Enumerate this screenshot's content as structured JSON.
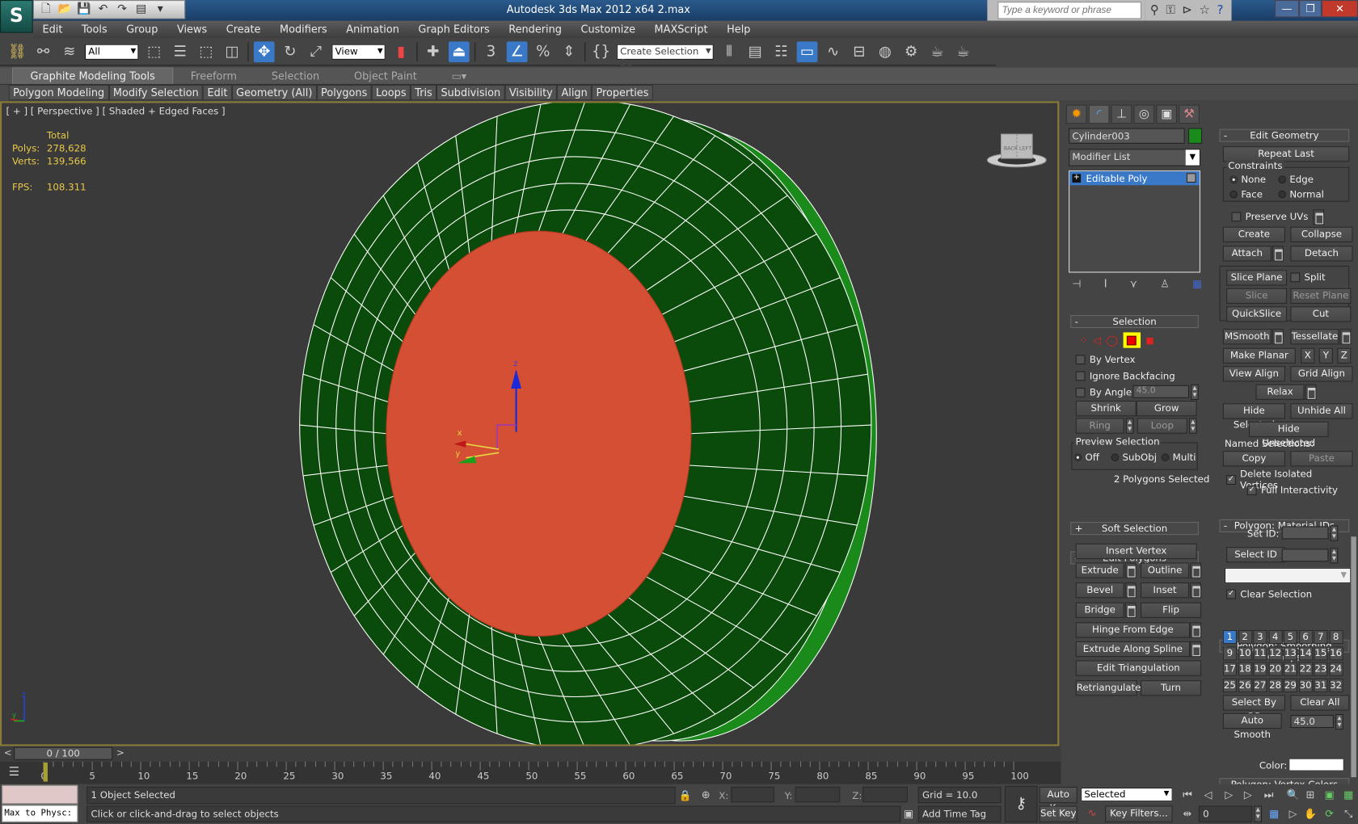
{
  "window": {
    "title": "Autodesk 3ds Max  2012 x64     2.max",
    "search_placeholder": "Type a keyword or phrase",
    "minimize": "—",
    "restore": "❐",
    "close": "✕"
  },
  "menubar": [
    "Edit",
    "Tools",
    "Group",
    "Views",
    "Create",
    "Modifiers",
    "Animation",
    "Graph Editors",
    "Rendering",
    "Customize",
    "MAXScript",
    "Help"
  ],
  "toolbar": {
    "selection_filter": "All",
    "ref_coord": "View",
    "named_selection_placeholder": "Create Selection Se",
    "snap_label": "3"
  },
  "ribbon": {
    "tabs": [
      "Graphite Modeling Tools",
      "Freeform",
      "Selection",
      "Object Paint"
    ],
    "panels": [
      "Polygon Modeling",
      "Modify Selection",
      "Edit",
      "Geometry (All)",
      "Polygons",
      "Loops",
      "Tris",
      "Subdivision",
      "Visibility",
      "Align",
      "Properties"
    ]
  },
  "viewport": {
    "label": "[ + ] [ Perspective ] [ Shaded + Edged Faces ]",
    "stats": {
      "header": "Total",
      "polys_label": "Polys:",
      "polys": "278,628",
      "verts_label": "Verts:",
      "verts": "139,566",
      "fps_label": "FPS:",
      "fps": "108.311"
    },
    "gizmo": {
      "x": "x",
      "y": "y",
      "z": "z"
    },
    "viewcube": {
      "left": "LEFT",
      "front": "BACK"
    },
    "colors": {
      "mesh": "#0a4a0a",
      "selection": "#d44f34",
      "mesh_edge": "#ffffff",
      "side": "#1a8a1a"
    }
  },
  "command_panel": {
    "object_name": "Cylinder003",
    "object_color": "#1a8a1a",
    "modifier_list": "Modifier List",
    "stack": [
      {
        "label": "Editable Poly",
        "selected": true
      }
    ],
    "selection": {
      "title": "Selection",
      "by_vertex": "By Vertex",
      "ignore_backfacing": "Ignore Backfacing",
      "by_angle": "By Angle:",
      "by_angle_value": "45.0",
      "shrink": "Shrink",
      "grow": "Grow",
      "ring": "Ring",
      "loop": "Loop",
      "preview_title": "Preview Selection",
      "preview_options": [
        "Off",
        "SubObj",
        "Multi"
      ],
      "preview_selected": "Off",
      "status": "2 Polygons Selected"
    },
    "soft_selection": "Soft Selection",
    "edit_polygons": {
      "title": "Edit Polygons",
      "insert_vertex": "Insert Vertex",
      "extrude": "Extrude",
      "outline": "Outline",
      "bevel": "Bevel",
      "inset": "Inset",
      "bridge": "Bridge",
      "flip": "Flip",
      "hinge": "Hinge From Edge",
      "extrude_spline": "Extrude Along Spline",
      "edit_tri": "Edit Triangulation",
      "retriangulate": "Retriangulate",
      "turn": "Turn"
    }
  },
  "edit_geometry": {
    "title": "Edit Geometry",
    "repeat_last": "Repeat Last",
    "constraints_title": "Constraints",
    "constraints": [
      "None",
      "Edge",
      "Face",
      "Normal"
    ],
    "constraint_selected": "None",
    "preserve_uvs": "Preserve UVs",
    "create": "Create",
    "collapse": "Collapse",
    "attach": "Attach",
    "detach": "Detach",
    "slice_plane": "Slice Plane",
    "split": "Split",
    "slice": "Slice",
    "reset_plane": "Reset Plane",
    "quickslice": "QuickSlice",
    "cut": "Cut",
    "msmooth": "MSmooth",
    "tessellate": "Tessellate",
    "make_planar": "Make Planar",
    "x": "X",
    "y": "Y",
    "z": "Z",
    "view_align": "View Align",
    "grid_align": "Grid Align",
    "relax": "Relax",
    "hide_selected": "Hide Selected",
    "unhide_all": "Unhide All",
    "hide_unselected": "Hide Unselected",
    "named_selections": "Named Selections:",
    "copy": "Copy",
    "paste": "Paste",
    "delete_isolated": "Delete Isolated Vertices",
    "full_interactivity": "Full Interactivity"
  },
  "material_ids": {
    "title": "Polygon: Material IDs",
    "set_id": "Set ID:",
    "select_id": "Select ID",
    "clear_selection": "Clear Selection"
  },
  "smoothing_groups": {
    "title": "Polygon: Smoothing Groups",
    "groups": [
      "1",
      "2",
      "3",
      "4",
      "5",
      "6",
      "7",
      "8",
      "9",
      "10",
      "11",
      "12",
      "13",
      "14",
      "15",
      "16",
      "17",
      "18",
      "19",
      "20",
      "21",
      "22",
      "23",
      "24",
      "25",
      "26",
      "27",
      "28",
      "29",
      "30",
      "31",
      "32"
    ],
    "active": [
      "1"
    ],
    "select_by_sg": "Select By SG",
    "clear_all": "Clear All",
    "auto_smooth": "Auto Smooth",
    "auto_smooth_value": "45.0"
  },
  "vertex_colors": {
    "title": "Polygon: Vertex Colors",
    "color": "Color:"
  },
  "timeline": {
    "frame_display": "0 / 100",
    "prev": "<",
    "next": ">",
    "ticks": [
      "0",
      "5",
      "10",
      "15",
      "20",
      "25",
      "30",
      "35",
      "40",
      "45",
      "50",
      "55",
      "60",
      "65",
      "70",
      "75",
      "80",
      "85",
      "90",
      "95",
      "100"
    ],
    "current_frame": 0
  },
  "status": {
    "maxscript_listener": "Max to Physc:",
    "selection_status": "1 Object Selected",
    "prompt": "Click or click-and-drag to select objects",
    "x_label": "X:",
    "y_label": "Y:",
    "z_label": "Z:",
    "grid": "Grid = 10.0",
    "add_time_tag": "Add Time Tag",
    "auto_key": "Auto Key",
    "set_key": "Set Key",
    "key_mode": "Selected",
    "key_filters": "Key Filters...",
    "frame_field": "0"
  }
}
